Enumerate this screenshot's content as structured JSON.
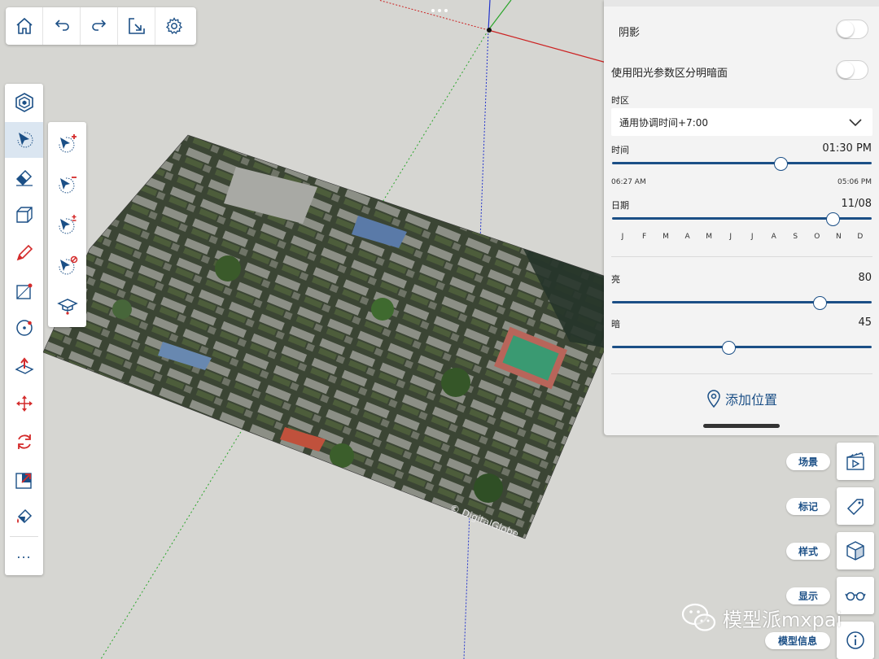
{
  "top_toolbar": {
    "items": [
      {
        "icon": "home-icon"
      },
      {
        "icon": "undo-icon"
      },
      {
        "icon": "redo-icon"
      },
      {
        "icon": "export-icon"
      },
      {
        "icon": "settings-icon"
      }
    ]
  },
  "left_toolbar": {
    "items": [
      {
        "icon": "view-cube-icon"
      },
      {
        "icon": "select-icon",
        "active": true
      },
      {
        "icon": "eraser-icon"
      },
      {
        "icon": "box-icon"
      },
      {
        "icon": "pencil-icon"
      },
      {
        "icon": "rectangle-icon"
      },
      {
        "icon": "circle-icon"
      },
      {
        "icon": "push-pull-icon"
      },
      {
        "icon": "move-icon"
      },
      {
        "icon": "rotate-icon"
      },
      {
        "icon": "scale-icon"
      },
      {
        "icon": "paint-bucket-icon"
      }
    ],
    "more_label": "..."
  },
  "select_flyout": {
    "items": [
      {
        "icon": "select-add-icon"
      },
      {
        "icon": "select-subtract-icon"
      },
      {
        "icon": "select-toggle-icon"
      },
      {
        "icon": "select-clear-icon"
      },
      {
        "icon": "tutorial-cap-icon"
      }
    ]
  },
  "shadow_panel": {
    "shadow_label": "阴影",
    "shadow_on": false,
    "sun_shading_label": "使用阳光参数区分明暗面",
    "sun_shading_on": false,
    "timezone_label": "时区",
    "timezone_value": "通用协调时间+7:00",
    "time_label": "时间",
    "time_value": "01:30 PM",
    "time_fraction": 0.65,
    "sunrise": "06:27 AM",
    "sunset": "05:06 PM",
    "date_label": "日期",
    "date_value": "11/08",
    "date_fraction": 0.85,
    "months": [
      "J",
      "F",
      "M",
      "A",
      "M",
      "J",
      "J",
      "A",
      "S",
      "O",
      "N",
      "D"
    ],
    "light_label": "亮",
    "light_value": "80",
    "light_fraction": 0.8,
    "dark_label": "暗",
    "dark_value": "45",
    "dark_fraction": 0.45,
    "add_location_label": "添加位置"
  },
  "tray": {
    "scenes_label": "场景",
    "tags_label": "标记",
    "styles_label": "样式",
    "display_label": "显示",
    "model_info_label": "模型信息"
  },
  "viewport": {
    "imagery_credit": "© DigitalGlobe"
  },
  "watermark": {
    "text": "模型派mxpai"
  },
  "colors": {
    "accent": "#1b4f86",
    "viewport_bg": "#d6d6d2",
    "panel_bg": "#f3f3f3",
    "red_axis": "#cc2222",
    "green_axis": "#2aa52a",
    "blue_axis": "#2233cc"
  }
}
